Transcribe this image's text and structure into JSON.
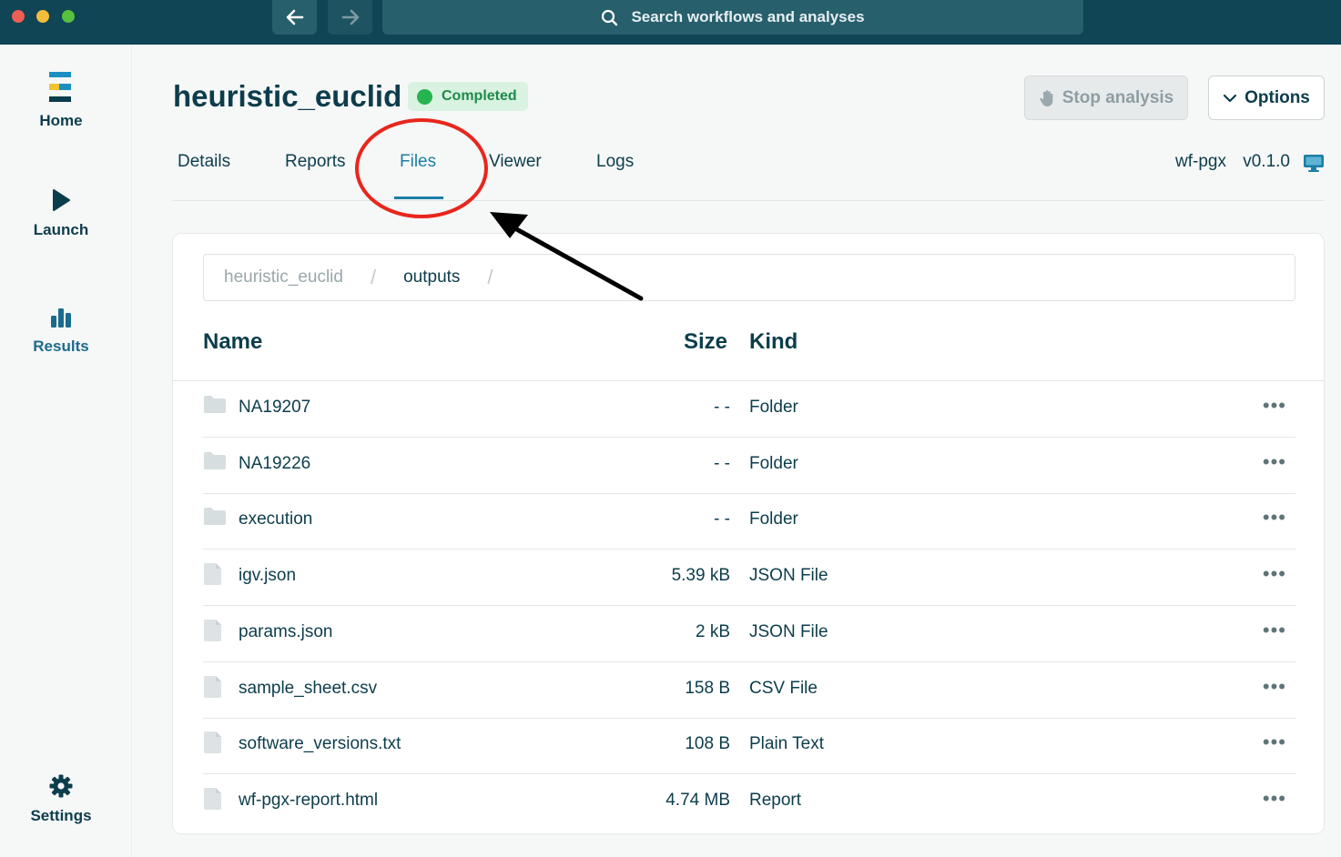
{
  "window": {
    "search_placeholder": "Search workflows and analyses"
  },
  "sidebar": {
    "items": [
      {
        "label": "Home",
        "icon": "home-logo-icon"
      },
      {
        "label": "Launch",
        "icon": "play-icon"
      },
      {
        "label": "Results",
        "icon": "bar-chart-icon",
        "active": true
      },
      {
        "label": "Settings",
        "icon": "gear-icon"
      }
    ]
  },
  "header": {
    "title": "heuristic_euclid",
    "status": "Completed",
    "stop_label": "Stop analysis",
    "options_label": "Options"
  },
  "tabs": {
    "items": [
      "Details",
      "Reports",
      "Files",
      "Viewer",
      "Logs"
    ],
    "active": "Files",
    "workflow_name": "wf-pgx",
    "workflow_version": "v0.1.0"
  },
  "files": {
    "breadcrumb": [
      "heuristic_euclid",
      "outputs"
    ],
    "columns": {
      "name": "Name",
      "size": "Size",
      "kind": "Kind"
    },
    "rows": [
      {
        "name": "NA19207",
        "size": "- -",
        "kind": "Folder",
        "icon": "folder-icon"
      },
      {
        "name": "NA19226",
        "size": "- -",
        "kind": "Folder",
        "icon": "folder-icon"
      },
      {
        "name": "execution",
        "size": "- -",
        "kind": "Folder",
        "icon": "folder-icon"
      },
      {
        "name": "igv.json",
        "size": "5.39 kB",
        "kind": "JSON File",
        "icon": "file-icon"
      },
      {
        "name": "params.json",
        "size": "2 kB",
        "kind": "JSON File",
        "icon": "file-icon"
      },
      {
        "name": "sample_sheet.csv",
        "size": "158 B",
        "kind": "CSV File",
        "icon": "file-icon"
      },
      {
        "name": "software_versions.txt",
        "size": "108 B",
        "kind": "Plain Text",
        "icon": "file-icon"
      },
      {
        "name": "wf-pgx-report.html",
        "size": "4.74 MB",
        "kind": "Report",
        "icon": "file-icon"
      }
    ],
    "more_label": "•••"
  },
  "colors": {
    "titlebar": "#0f4554",
    "accent": "#1b7fa6",
    "status_green": "#27b34f",
    "annotation_red": "#e8261c"
  }
}
